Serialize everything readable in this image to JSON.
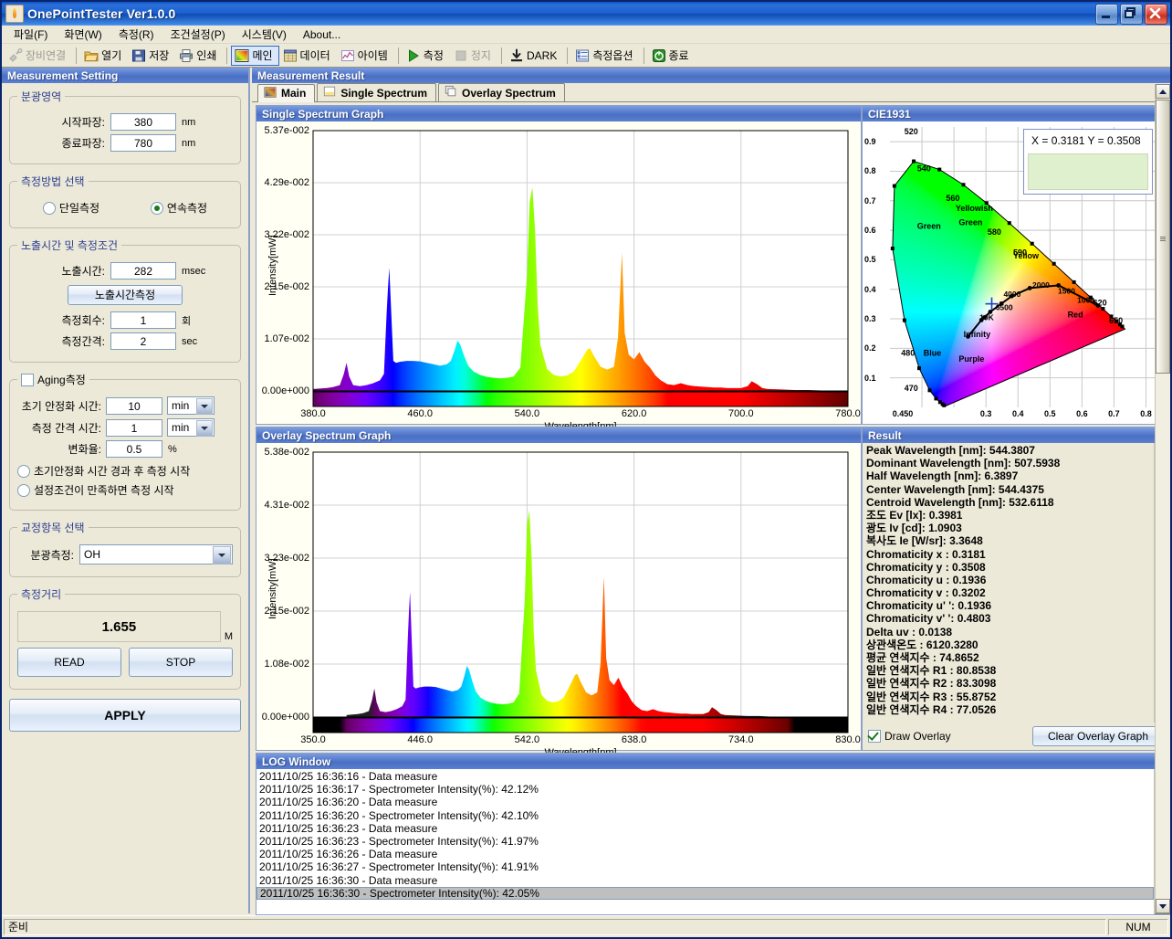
{
  "window": {
    "title": "OnePointTester Ver1.0.0",
    "icon": "flame-icon",
    "buttons": [
      {
        "name": "minimize-button",
        "glyph": "minimize"
      },
      {
        "name": "restore-button",
        "glyph": "restore"
      },
      {
        "name": "close-button",
        "glyph": "close"
      }
    ]
  },
  "menubar": [
    {
      "label": "파일(F)",
      "name": "menu-file"
    },
    {
      "label": "화면(W)",
      "name": "menu-view"
    },
    {
      "label": "측정(R)",
      "name": "menu-measure"
    },
    {
      "label": "조건설정(P)",
      "name": "menu-settings"
    },
    {
      "label": "시스템(V)",
      "name": "menu-system"
    },
    {
      "label": "About...",
      "name": "menu-about"
    }
  ],
  "toolbar": [
    {
      "label": "장비연결",
      "icon": "plug-connect-icon",
      "state": "disabled",
      "name": "toolbar-connect"
    },
    {
      "sep": true
    },
    {
      "label": "열기",
      "icon": "open-folder-icon",
      "state": "normal",
      "name": "toolbar-open"
    },
    {
      "label": "저장",
      "icon": "save-disk-icon",
      "state": "normal",
      "name": "toolbar-save"
    },
    {
      "label": "인쇄",
      "icon": "printer-icon",
      "state": "normal",
      "name": "toolbar-print"
    },
    {
      "sep": true
    },
    {
      "label": "메인",
      "icon": "main-chart-icon",
      "state": "active",
      "name": "toolbar-main"
    },
    {
      "label": "데이터",
      "icon": "data-grid-icon",
      "state": "normal",
      "name": "toolbar-data"
    },
    {
      "label": "아이템",
      "icon": "item-graph-icon",
      "state": "normal",
      "name": "toolbar-item"
    },
    {
      "sep": true
    },
    {
      "label": "측정",
      "icon": "play-green-icon",
      "state": "normal",
      "name": "toolbar-measure"
    },
    {
      "label": "정지",
      "icon": "stop-square-icon",
      "state": "disabled",
      "name": "toolbar-stop"
    },
    {
      "sep": true
    },
    {
      "label": "DARK",
      "icon": "download-dark-icon",
      "state": "normal",
      "name": "toolbar-dark"
    },
    {
      "sep": true
    },
    {
      "label": "측정옵션",
      "icon": "options-list-icon",
      "state": "normal",
      "name": "toolbar-options"
    },
    {
      "sep": true
    },
    {
      "label": "종료",
      "icon": "power-exit-icon",
      "state": "normal",
      "name": "toolbar-exit"
    }
  ],
  "left_panel": {
    "caption": "Measurement Setting",
    "spectral_range": {
      "legend": "분광영역",
      "start_label": "시작파장:",
      "start_value": "380",
      "start_unit": "nm",
      "end_label": "종료파장:",
      "end_value": "780",
      "end_unit": "nm"
    },
    "method": {
      "legend": "측정방법 선택",
      "single_label": "단일측정",
      "single_selected": false,
      "continuous_label": "연속측정",
      "continuous_selected": true
    },
    "exposure": {
      "legend": "노출시간 및 측정조건",
      "exposure_label": "노출시간:",
      "exposure_value": "282",
      "exposure_unit": "msec",
      "measure_exposure_button": "노출시간측정",
      "count_label": "측정회수:",
      "count_value": "1",
      "count_unit": "회",
      "interval_label": "측정간격:",
      "interval_value": "2",
      "interval_unit": "sec"
    },
    "aging": {
      "legend": "Aging측정",
      "enabled": false,
      "stabilize_label": "초기 안정화 시간:",
      "stabilize_value": "10",
      "stabilize_unit": "min",
      "interval_label": "측정 간격 시간:",
      "interval_value": "1",
      "interval_unit": "min",
      "rate_label": "변화율:",
      "rate_value": "0.5",
      "rate_unit": "%",
      "option1_label": "초기안정화 시간 경과 후 측정 시작",
      "option1_selected": false,
      "option2_label": "설정조건이 만족하면 측정 시작",
      "option2_selected": false
    },
    "calibration": {
      "legend": "교정항목 선택",
      "label": "분광측정:",
      "value": "OH"
    },
    "distance": {
      "legend": "측정거리",
      "value": "1.655",
      "unit": "M",
      "read_button": "READ",
      "stop_button": "STOP"
    },
    "apply_button": "APPLY"
  },
  "right_panel": {
    "caption": "Measurement Result",
    "tabs": [
      {
        "label": "Main",
        "icon": "main-tab-icon",
        "selected": true,
        "name": "tab-main"
      },
      {
        "label": "Single Spectrum",
        "icon": "single-spectrum-tab-icon",
        "selected": false,
        "name": "tab-single-spectrum"
      },
      {
        "label": "Overlay Spectrum",
        "icon": "overlay-spectrum-tab-icon",
        "selected": false,
        "name": "tab-overlay-spectrum"
      }
    ]
  },
  "chart_data": [
    {
      "type": "area",
      "panel_caption": "Single Spectrum Graph",
      "title": "Single Spectrum Graph",
      "xlabel": "Wavelength[nm]",
      "ylabel": "Intensity[mW]",
      "xlim": [
        380.0,
        780.0
      ],
      "ylim": [
        0.0,
        0.0537
      ],
      "xticks": [
        "380.0",
        "460.0",
        "540.0",
        "620.0",
        "700.0",
        "780.0"
      ],
      "yticks": [
        "0.00e+000",
        "1.07e-002",
        "2.15e-002",
        "3.22e-002",
        "4.29e-002",
        "5.37e-002"
      ],
      "grid": true,
      "peaks_nm": [
        405,
        437,
        488,
        544,
        587,
        611,
        708
      ],
      "x": [
        380,
        385,
        390,
        395,
        400,
        403,
        405,
        407,
        410,
        415,
        420,
        425,
        430,
        433,
        435,
        436,
        437,
        438,
        440,
        442,
        445,
        450,
        455,
        460,
        465,
        470,
        475,
        480,
        483,
        486,
        488,
        490,
        493,
        496,
        500,
        505,
        510,
        515,
        520,
        525,
        530,
        535,
        540,
        542,
        544,
        546,
        548,
        550,
        555,
        560,
        565,
        570,
        575,
        580,
        585,
        587,
        590,
        595,
        600,
        605,
        608,
        611,
        613,
        616,
        620,
        624,
        628,
        632,
        636,
        640,
        645,
        650,
        655,
        660,
        665,
        670,
        675,
        680,
        685,
        690,
        695,
        700,
        705,
        708,
        712,
        716,
        720,
        730,
        740,
        750,
        760,
        770,
        780
      ],
      "y": [
        0.0004,
        0.0005,
        0.0006,
        0.0008,
        0.0012,
        0.0035,
        0.0058,
        0.003,
        0.0012,
        0.001,
        0.0012,
        0.0016,
        0.0022,
        0.0035,
        0.016,
        0.0212,
        0.0254,
        0.019,
        0.0062,
        0.0058,
        0.006,
        0.0062,
        0.0062,
        0.0061,
        0.0058,
        0.0055,
        0.0052,
        0.0055,
        0.0062,
        0.0085,
        0.0104,
        0.0096,
        0.0072,
        0.0052,
        0.004,
        0.0033,
        0.0029,
        0.0027,
        0.0026,
        0.0027,
        0.003,
        0.0048,
        0.024,
        0.039,
        0.042,
        0.033,
        0.0175,
        0.0095,
        0.0045,
        0.0033,
        0.003,
        0.0032,
        0.004,
        0.0062,
        0.0085,
        0.0088,
        0.0072,
        0.005,
        0.0044,
        0.005,
        0.011,
        0.0285,
        0.012,
        0.0075,
        0.0065,
        0.008,
        0.006,
        0.0048,
        0.0032,
        0.0022,
        0.0014,
        0.0012,
        0.0016,
        0.0012,
        0.001,
        0.0009,
        0.0008,
        0.0007,
        0.0007,
        0.0006,
        0.0006,
        0.0006,
        0.001,
        0.002,
        0.0014,
        0.0006,
        0.0004,
        0.0003,
        0.0002,
        0.0002,
        0.0001,
        0.0001,
        0.0001
      ]
    },
    {
      "type": "area",
      "panel_caption": "Overlay Spectrum Graph",
      "title": "Overlay Spectrum Graph",
      "xlabel": "Wavelength[nm]",
      "ylabel": "Intensity[mW]",
      "xlim": [
        350.0,
        830.0
      ],
      "ylim": [
        0.0,
        0.0538
      ],
      "xticks": [
        "350.0",
        "446.0",
        "542.0",
        "638.0",
        "734.0",
        "830.0"
      ],
      "yticks": [
        "0.00e+000",
        "1.08e-002",
        "2.15e-002",
        "3.23e-002",
        "4.31e-002",
        "5.38e-002"
      ],
      "grid": true,
      "peaks_nm": [
        405,
        437,
        488,
        544,
        587,
        611,
        708
      ]
    }
  ],
  "cie": {
    "caption": "CIE1931",
    "readout": "X = 0.3181  Y = 0.3508",
    "x_value": 0.3181,
    "y_value": 0.3508,
    "xticks": [
      "0.450",
      "0.3",
      "0.4",
      "0.5",
      "0.6",
      "0.7",
      "0.8"
    ],
    "yticks": [
      "0.9",
      "0.8",
      "0.7",
      "0.6",
      "0.5",
      "0.4",
      "0.3",
      "0.2",
      "0.1"
    ],
    "region_labels": [
      "Green",
      "Yellowish Green",
      "Yellow",
      "Red",
      "Purple",
      "Blue"
    ],
    "wavelength_labels": [
      "520",
      "540",
      "560",
      "580",
      "590",
      "620",
      "650",
      "480",
      "470",
      "450"
    ],
    "cct_labels": [
      "2000",
      "1500",
      "1000",
      "4000",
      "6500",
      "10K",
      "Infinity"
    ]
  },
  "result": {
    "caption": "Result",
    "lines": [
      "Peak Wavelength [nm]: 544.3807",
      "Dominant Wavelength [nm]: 507.5938",
      "Half Wavelength [nm]: 6.3897",
      "Center Wavelength [nm]: 544.4375",
      "Centroid Wavelength [nm]: 532.6118",
      "조도 Ev [lx]: 0.3981",
      "광도 Iv [cd]: 1.0903",
      "복사도 Ie [W/sr]: 3.3648",
      "Chromaticity x : 0.3181",
      "Chromaticity y : 0.3508",
      "Chromaticity u : 0.1936",
      "Chromaticity v : 0.3202",
      "Chromaticity u' ': 0.1936",
      "Chromaticity v' ': 0.4803",
      "Delta uv : 0.0138",
      "상관색온도 : 6120.3280",
      "평균 연색지수 : 74.8652",
      "일반 연색지수 R1 : 80.8538",
      "일반 연색지수 R2 : 83.3098",
      "일반 연색지수 R3 : 55.8752",
      "일반 연색지수 R4 : 77.0526"
    ],
    "draw_overlay_label": "Draw Overlay",
    "draw_overlay_checked": true,
    "clear_button": "Clear Overlay Graph"
  },
  "log": {
    "caption": "LOG Window",
    "lines": [
      {
        "text": "2011/10/25 16:36:16 - Data measure",
        "selected": false
      },
      {
        "text": "2011/10/25 16:36:17 - Spectrometer Intensity(%): 42.12%",
        "selected": false
      },
      {
        "text": "2011/10/25 16:36:20 - Data measure",
        "selected": false
      },
      {
        "text": "2011/10/25 16:36:20 - Spectrometer Intensity(%): 42.10%",
        "selected": false
      },
      {
        "text": "2011/10/25 16:36:23 - Data measure",
        "selected": false
      },
      {
        "text": "2011/10/25 16:36:23 - Spectrometer Intensity(%): 41.97%",
        "selected": false
      },
      {
        "text": "2011/10/25 16:36:26 - Data measure",
        "selected": false
      },
      {
        "text": "2011/10/25 16:36:27 - Spectrometer Intensity(%): 41.91%",
        "selected": false
      },
      {
        "text": "2011/10/25 16:36:30 - Data measure",
        "selected": false
      },
      {
        "text": "2011/10/25 16:36:30 - Spectrometer Intensity(%): 42.05%",
        "selected": true
      }
    ]
  },
  "statusbar": {
    "left_text": "준비",
    "right_text": "NUM"
  },
  "colors": {
    "caption_start": "#7b9ee0",
    "caption_end": "#4a6fc4",
    "window_border": "#0a246a",
    "panel_bg": "#ece9d8",
    "plot_bg": "#ffffff",
    "accent": "#2e3f8f"
  }
}
